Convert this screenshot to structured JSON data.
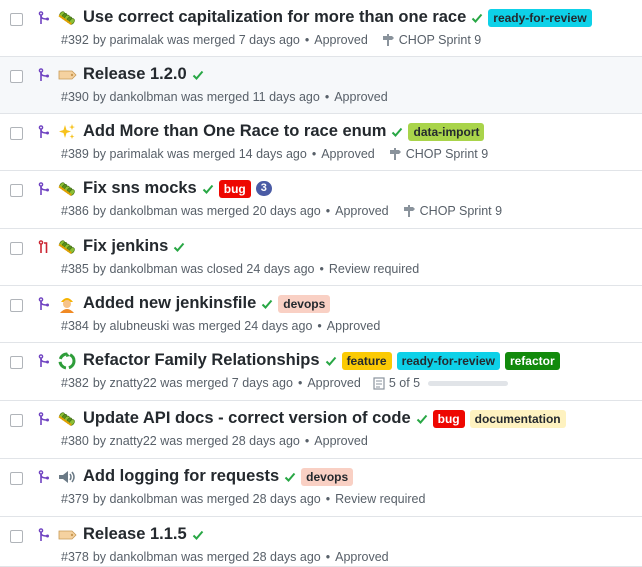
{
  "colors": {
    "merged": "#6f42c1",
    "closed": "#cb2431",
    "check": "#28a745",
    "muted": "#586069",
    "border": "#e1e4e8"
  },
  "issues": [
    {
      "state_icon": "merged-pr-icon",
      "emoji_icon": "bug-emoji-icon",
      "title": "Use correct capitalization for more than one race",
      "labels": [
        {
          "name": "ready-for-review",
          "bg": "#0ed1e8",
          "fg": "#24292e"
        }
      ],
      "number": "#392",
      "by_line": "by parimalak was merged 7 days ago",
      "status": "Approved",
      "milestone": "CHOP Sprint 9"
    },
    {
      "state_icon": "merged-pr-icon",
      "emoji_icon": "label-tag-emoji-icon",
      "title": "Release 1.2.0",
      "labels": [],
      "number": "#390",
      "by_line": "by dankolbman was merged 11 days ago",
      "status": "Approved"
    },
    {
      "state_icon": "merged-pr-icon",
      "emoji_icon": "sparkles-emoji-icon",
      "title": "Add More than One Race to race enum",
      "labels": [
        {
          "name": "data-import",
          "bg": "#a9d44a",
          "fg": "#24292e"
        }
      ],
      "number": "#389",
      "by_line": "by parimalak was merged 14 days ago",
      "status": "Approved",
      "milestone": "CHOP Sprint 9"
    },
    {
      "state_icon": "merged-pr-icon",
      "emoji_icon": "bug-emoji-icon",
      "title": "Fix sns mocks",
      "labels": [
        {
          "name": "bug",
          "bg": "#ee0701",
          "fg": "#ffffff"
        }
      ],
      "comment_count": "3",
      "number": "#386",
      "by_line": "by dankolbman was merged 20 days ago",
      "status": "Approved",
      "milestone": "CHOP Sprint 9"
    },
    {
      "state_icon": "closed-pr-icon",
      "emoji_icon": "bug-emoji-icon",
      "title": "Fix jenkins",
      "labels": [],
      "number": "#385",
      "by_line": "by dankolbman was closed 24 days ago",
      "status": "Review required"
    },
    {
      "state_icon": "merged-pr-icon",
      "emoji_icon": "construction-worker-emoji-icon",
      "title": "Added new jenkinsfile",
      "labels": [
        {
          "name": "devops",
          "bg": "#f9d0c4",
          "fg": "#24292e"
        }
      ],
      "number": "#384",
      "by_line": "by alubneuski was merged 24 days ago",
      "status": "Approved"
    },
    {
      "state_icon": "merged-pr-icon",
      "emoji_icon": "recycle-emoji-icon",
      "title": "Refactor Family Relationships",
      "labels": [
        {
          "name": "feature",
          "bg": "#fbca04",
          "fg": "#24292e"
        },
        {
          "name": "ready-for-review",
          "bg": "#0ed1e8",
          "fg": "#24292e"
        },
        {
          "name": "refactor",
          "bg": "#128a0c",
          "fg": "#ffffff"
        }
      ],
      "number": "#382",
      "by_line": "by znatty22 was merged 7 days ago",
      "status": "Approved",
      "tasks": "5 of 5"
    },
    {
      "state_icon": "merged-pr-icon",
      "emoji_icon": "bug-emoji-icon",
      "title": "Update API docs - correct version of code",
      "labels": [
        {
          "name": "bug",
          "bg": "#ee0701",
          "fg": "#ffffff"
        },
        {
          "name": "documentation",
          "bg": "#fef2c0",
          "fg": "#24292e"
        }
      ],
      "number": "#380",
      "by_line": "by znatty22 was merged 28 days ago",
      "status": "Approved"
    },
    {
      "state_icon": "merged-pr-icon",
      "emoji_icon": "speaker-emoji-icon",
      "title": "Add logging for requests",
      "labels": [
        {
          "name": "devops",
          "bg": "#f9d0c4",
          "fg": "#24292e"
        }
      ],
      "number": "#379",
      "by_line": "by dankolbman was merged 28 days ago",
      "status": "Review required"
    },
    {
      "state_icon": "merged-pr-icon",
      "emoji_icon": "label-tag-emoji-icon",
      "title": "Release 1.1.5",
      "labels": [],
      "number": "#378",
      "by_line": "by dankolbman was merged 28 days ago",
      "status": "Approved"
    }
  ]
}
